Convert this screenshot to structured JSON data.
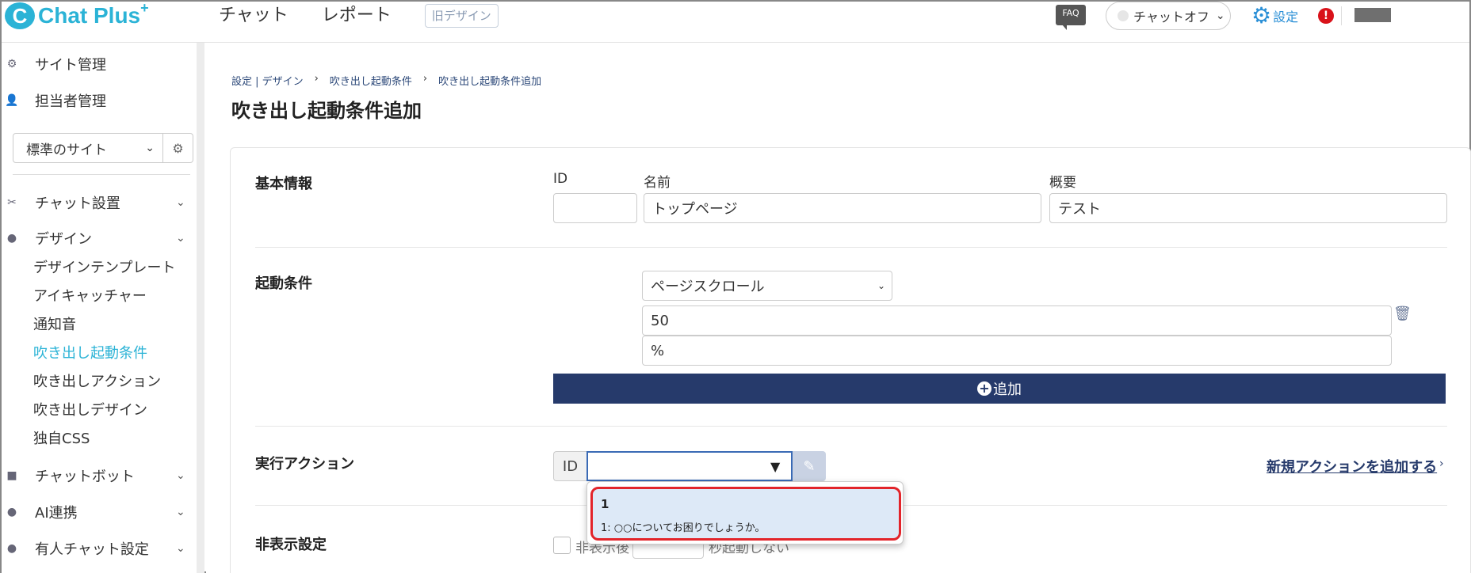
{
  "header": {
    "logo_text": "Chat Plus",
    "logo_plus": "+",
    "logo_mark": "C",
    "nav": [
      "チャット",
      "レポート"
    ],
    "old_design": "旧デザイン",
    "faq": "FAQ",
    "chat_status": "チャットオフ",
    "settings": "設定",
    "alert": "!"
  },
  "sidebar": {
    "site_manage": "サイト管理",
    "staff_manage": "担当者管理",
    "site_select": "標準のサイト",
    "items": [
      {
        "label": "チャット設置"
      },
      {
        "label": "デザイン"
      },
      {
        "label": "チャットボット"
      },
      {
        "label": "AI連携"
      },
      {
        "label": "有人チャット設定"
      }
    ],
    "design_sub": [
      "デザインテンプレート",
      "アイキャッチャー",
      "通知音",
      "吹き出し起動条件",
      "吹き出しアクション",
      "吹き出しデザイン",
      "独自CSS"
    ]
  },
  "main": {
    "breadcrumb": [
      "設定 | デザイン",
      "吹き出し起動条件",
      "吹き出し起動条件追加"
    ],
    "title": "吹き出し起動条件追加",
    "basic": {
      "title": "基本情報",
      "id_label": "ID",
      "name_label": "名前",
      "summary_label": "概要",
      "id_value": "",
      "name_value": "トップページ",
      "summary_value": "テスト"
    },
    "trigger": {
      "title": "起動条件",
      "type_value": "ページスクロール",
      "scroll_value": "50",
      "unit_value": "%",
      "add_label": "追加"
    },
    "action": {
      "title": "実行アクション",
      "id_prefix": "ID",
      "new_action": "新規アクションを追加する",
      "option_id": "1",
      "option_text": "1: ○○についてお困りでしょうか。"
    },
    "hide": {
      "title": "非表示設定",
      "text_before": "非表示後",
      "text_after": "秒起動しない"
    }
  }
}
